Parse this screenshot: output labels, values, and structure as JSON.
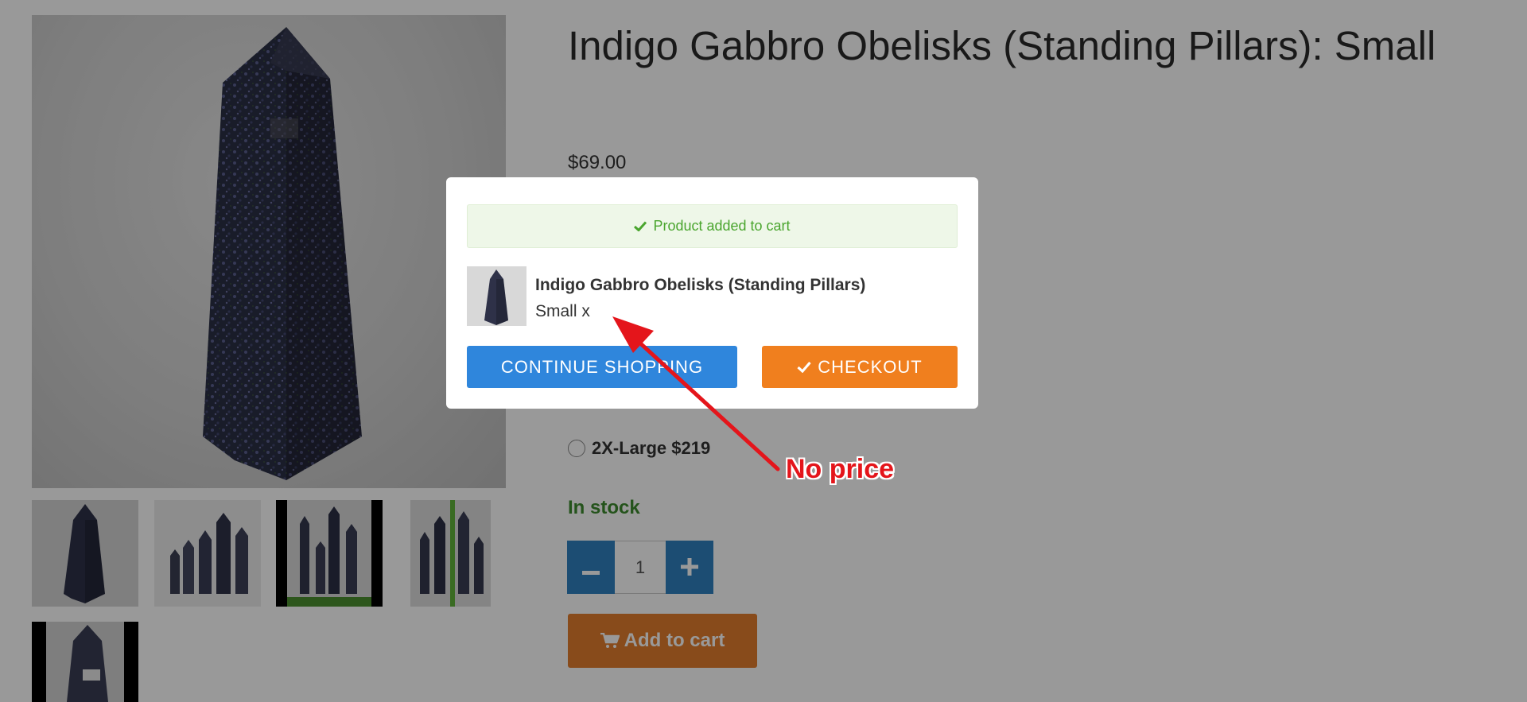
{
  "product": {
    "title": "Indigo Gabbro Obelisks (Standing Pillars): Small",
    "price": "$69.00",
    "options": [
      {
        "label": "2X-Large $219",
        "selected": false
      }
    ],
    "stock_status": "In stock",
    "quantity": "1",
    "add_to_cart_label": "Add to cart"
  },
  "gallery": {
    "thumbnail_count": 5
  },
  "modal": {
    "notice": "Product added to cart",
    "item_name": "Indigo Gabbro Obelisks (Standing Pillars)",
    "item_variant": "Small x",
    "continue_label": "CONTINUE SHOPPING",
    "checkout_label": "CHECKOUT"
  },
  "annotation": {
    "label": "No price"
  },
  "colors": {
    "primary_blue": "#2f86dc",
    "checkout_orange": "#f07f1e",
    "add_to_cart": "#e37d2d",
    "success_green": "#4aa52e",
    "stock_green": "#3c8a2e",
    "annotation_red": "#e4151b"
  },
  "icons": {
    "notice": "check-icon",
    "checkout": "check-icon",
    "add_to_cart": "cart-icon",
    "quantity_decrease": "minus-icon",
    "quantity_increase": "plus-icon"
  }
}
